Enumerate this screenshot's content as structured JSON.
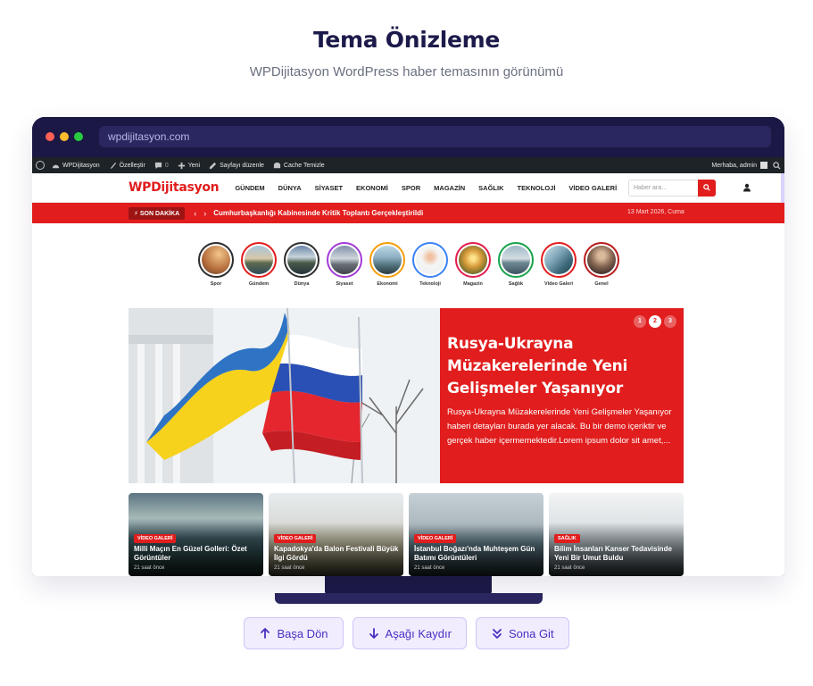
{
  "page": {
    "title": "Tema Önizleme",
    "subtitle": "WPDijitasyon WordPress haber temasının görünümü"
  },
  "browser": {
    "url": "wpdijitasyon.com"
  },
  "wp_admin_bar": {
    "items": [
      {
        "label": "WPDijitasyon",
        "icon": "dashboard-icon"
      },
      {
        "label": "Özelleştir",
        "icon": "brush-icon"
      },
      {
        "label": "0",
        "icon": "comment-icon"
      },
      {
        "label": "Yeni",
        "icon": "plus-icon"
      },
      {
        "label": "Sayfayı düzenle",
        "icon": "pencil-icon"
      },
      {
        "label": "Cache Temizle",
        "icon": "cache-icon"
      }
    ],
    "greeting": "Merhaba, admin"
  },
  "site": {
    "logo": "WPDijitasyon",
    "nav": [
      "GÜNDEM",
      "DÜNYA",
      "SİYASET",
      "EKONOMİ",
      "SPOR",
      "MAGAZİN",
      "SAĞLIK",
      "TEKNOLOJİ",
      "VİDEO GALERİ"
    ],
    "search_placeholder": "Haber ara..."
  },
  "breaking": {
    "badge": "⚡ SON DAKİKA",
    "prev": "‹",
    "next": "›",
    "headline": "Cumhurbaşkanlığı Kabinesinde Kritik Toplantı Gerçekleştirildi",
    "date": "13 Mart 2026, Cuma"
  },
  "stories": [
    {
      "label": "Spor",
      "ring": "#2d2d2d"
    },
    {
      "label": "Gündem",
      "ring": "#e11d1d"
    },
    {
      "label": "Dünya",
      "ring": "#2d2d2d"
    },
    {
      "label": "Siyaset",
      "ring": "#a23bd6"
    },
    {
      "label": "Ekonomi",
      "ring": "#f59e0b"
    },
    {
      "label": "Teknoloji",
      "ring": "#3b82f6"
    },
    {
      "label": "Magazin",
      "ring": "#e11d4d"
    },
    {
      "label": "Sağlık",
      "ring": "#16a34a"
    },
    {
      "label": "Video Galeri",
      "ring": "#e11d1d"
    },
    {
      "label": "Genel",
      "ring": "#b91c1c"
    }
  ],
  "hero": {
    "title": "Rusya-Ukrayna Müzakerelerinde Yeni Gelişmeler Yaşanıyor",
    "description": "Rusya-Ukrayna Müzakerelerinde Yeni Gelişmeler Yaşanıyor haberi detayları burada yer alacak. Bu bir demo içeriktir ve gerçek haber içermemektedir.Lorem ipsum dolor sit amet,...",
    "pages": [
      "1",
      "2",
      "3"
    ],
    "active_page": "2"
  },
  "cards": [
    {
      "badge": "VİDEO GALERİ",
      "title": "Milli Maçın En Güzel Golleri: Özet Görüntüler",
      "time": "21 saat önce"
    },
    {
      "badge": "VİDEO GALERİ",
      "title": "Kapadokya'da Balon Festivali Büyük İlgi Gördü",
      "time": "21 saat önce"
    },
    {
      "badge": "VİDEO GALERİ",
      "title": "İstanbul Boğazı'nda Muhteşem Gün Batımı Görüntüleri",
      "time": "21 saat önce"
    },
    {
      "badge": "SAĞLIK",
      "title": "Bilim İnsanları Kanser Tedavisinde Yeni Bir Umut Buldu",
      "time": "21 saat önce"
    }
  ],
  "actions": [
    {
      "label": "Başa Dön",
      "icon": "arrow-up-icon"
    },
    {
      "label": "Aşağı Kaydır",
      "icon": "arrow-down-icon"
    },
    {
      "label": "Sona Git",
      "icon": "double-chevron-down-icon"
    }
  ]
}
